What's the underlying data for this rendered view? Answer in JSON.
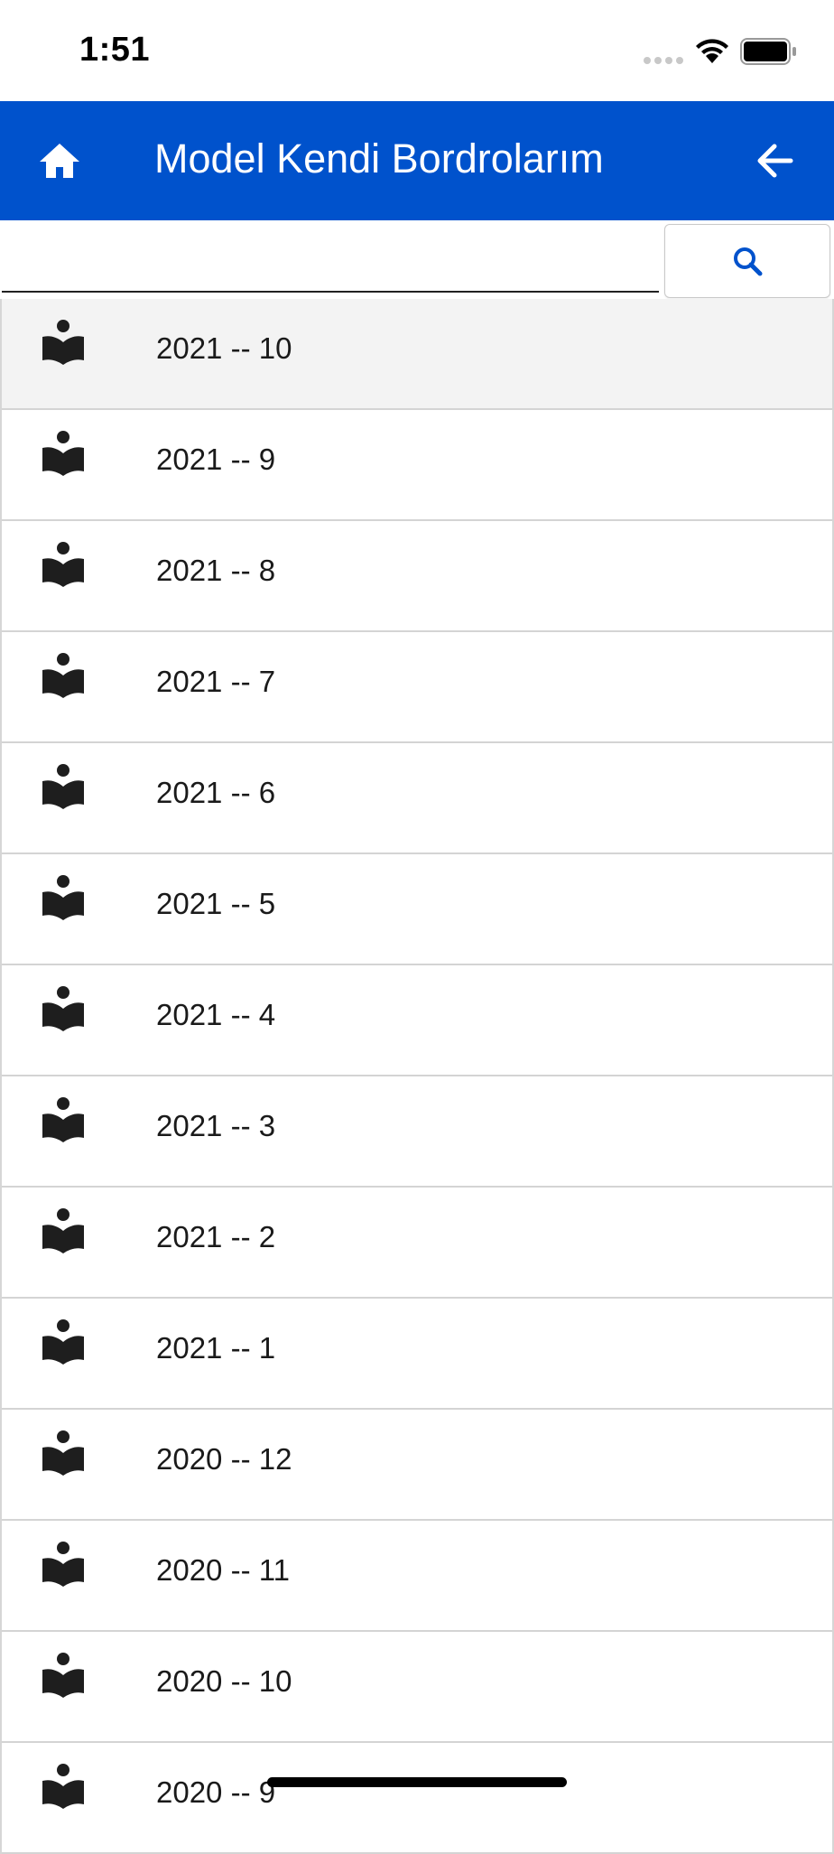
{
  "status_bar": {
    "time": "1:51"
  },
  "header": {
    "title": "Model Kendi Bordrolarım",
    "home_icon": "home-icon",
    "back_icon": "arrow-left-icon",
    "background": "#0052cc"
  },
  "search": {
    "value": "",
    "placeholder": "",
    "button_icon": "search-icon",
    "icon_color": "#0052cc"
  },
  "list": {
    "item_icon": "person-reading-book-icon",
    "items": [
      {
        "label": "2021 -- 10",
        "selected": true
      },
      {
        "label": "2021 -- 9",
        "selected": false
      },
      {
        "label": "2021 -- 8",
        "selected": false
      },
      {
        "label": "2021 -- 7",
        "selected": false
      },
      {
        "label": "2021 -- 6",
        "selected": false
      },
      {
        "label": "2021 -- 5",
        "selected": false
      },
      {
        "label": "2021 -- 4",
        "selected": false
      },
      {
        "label": "2021 -- 3",
        "selected": false
      },
      {
        "label": "2021 -- 2",
        "selected": false
      },
      {
        "label": "2021 -- 1",
        "selected": false
      },
      {
        "label": "2020 -- 12",
        "selected": false
      },
      {
        "label": "2020 -- 11",
        "selected": false
      },
      {
        "label": "2020 -- 10",
        "selected": false
      },
      {
        "label": "2020 -- 9",
        "selected": false
      }
    ]
  }
}
